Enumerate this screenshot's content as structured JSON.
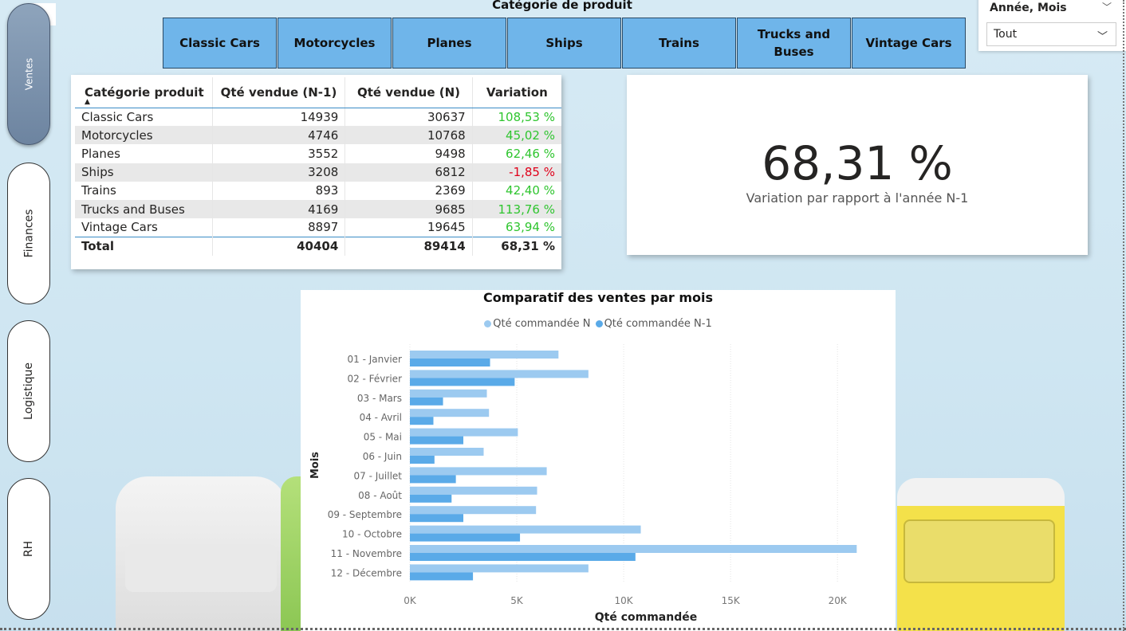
{
  "nav": {
    "items": [
      {
        "label": "Ventes",
        "active": true
      },
      {
        "label": "Finances",
        "active": false
      },
      {
        "label": "Logistique",
        "active": false
      },
      {
        "label": "RH",
        "active": false
      }
    ],
    "more_label": "..."
  },
  "category_slicer": {
    "title": "Catégorie de produit",
    "buttons": [
      "Classic Cars",
      "Motorcycles",
      "Planes",
      "Ships",
      "Trains",
      "Trucks and Buses",
      "Vintage Cars"
    ]
  },
  "period_slicer": {
    "title": "Année, Mois",
    "selected": "Tout"
  },
  "table": {
    "headers": [
      "Catégorie produit",
      "Qté vendue (N-1)",
      "Qté vendue (N)",
      "Variation"
    ],
    "rows": [
      [
        "Classic Cars",
        "14939",
        "30637",
        "108,53 %"
      ],
      [
        "Motorcycles",
        "4746",
        "10768",
        "45,02 %"
      ],
      [
        "Planes",
        "3552",
        "9498",
        "62,46 %"
      ],
      [
        "Ships",
        "3208",
        "6812",
        "-1,85 %"
      ],
      [
        "Trains",
        "893",
        "2369",
        "42,40 %"
      ],
      [
        "Trucks and Buses",
        "4169",
        "9685",
        "113,76 %"
      ],
      [
        "Vintage Cars",
        "8897",
        "19645",
        "63,94 %"
      ]
    ],
    "total": [
      "Total",
      "40404",
      "89414",
      "68,31 %"
    ]
  },
  "kpi": {
    "value": "68,31 %",
    "label": "Variation par rapport à l'année N-1"
  },
  "colors": {
    "series_n": "#9ccaf0",
    "series_n1": "#5aaae8",
    "positive": "#2fc52f",
    "negative": "#e0001a",
    "slicer_button": "#6fb5ea"
  },
  "chart_data": {
    "type": "bar",
    "orientation": "horizontal",
    "title": "Comparatif des ventes par mois",
    "xlabel": "Qté commandée",
    "ylabel": "Mois",
    "categories": [
      "01 - Janvier",
      "02 - Février",
      "03 - Mars",
      "04 - Avril",
      "05 - Mai",
      "06 - Juin",
      "07 - Juillet",
      "08 - Août",
      "09 - Septembre",
      "10 - Octobre",
      "11 - Novembre",
      "12 - Décembre"
    ],
    "series": [
      {
        "name": "Qté commandée N",
        "values": [
          6950,
          8350,
          3600,
          3700,
          5050,
          3450,
          6400,
          5950,
          5900,
          10800,
          20900,
          8350
        ]
      },
      {
        "name": "Qté commandée N-1",
        "values": [
          3750,
          4900,
          1550,
          1100,
          2500,
          1150,
          2150,
          1950,
          2500,
          5150,
          10550,
          2950
        ]
      }
    ],
    "xlim": [
      0,
      21000
    ],
    "xticks": [
      "0K",
      "5K",
      "10K",
      "15K",
      "20K"
    ],
    "xtick_values": [
      0,
      5000,
      10000,
      15000,
      20000
    ],
    "legend": "top",
    "grid": true
  }
}
